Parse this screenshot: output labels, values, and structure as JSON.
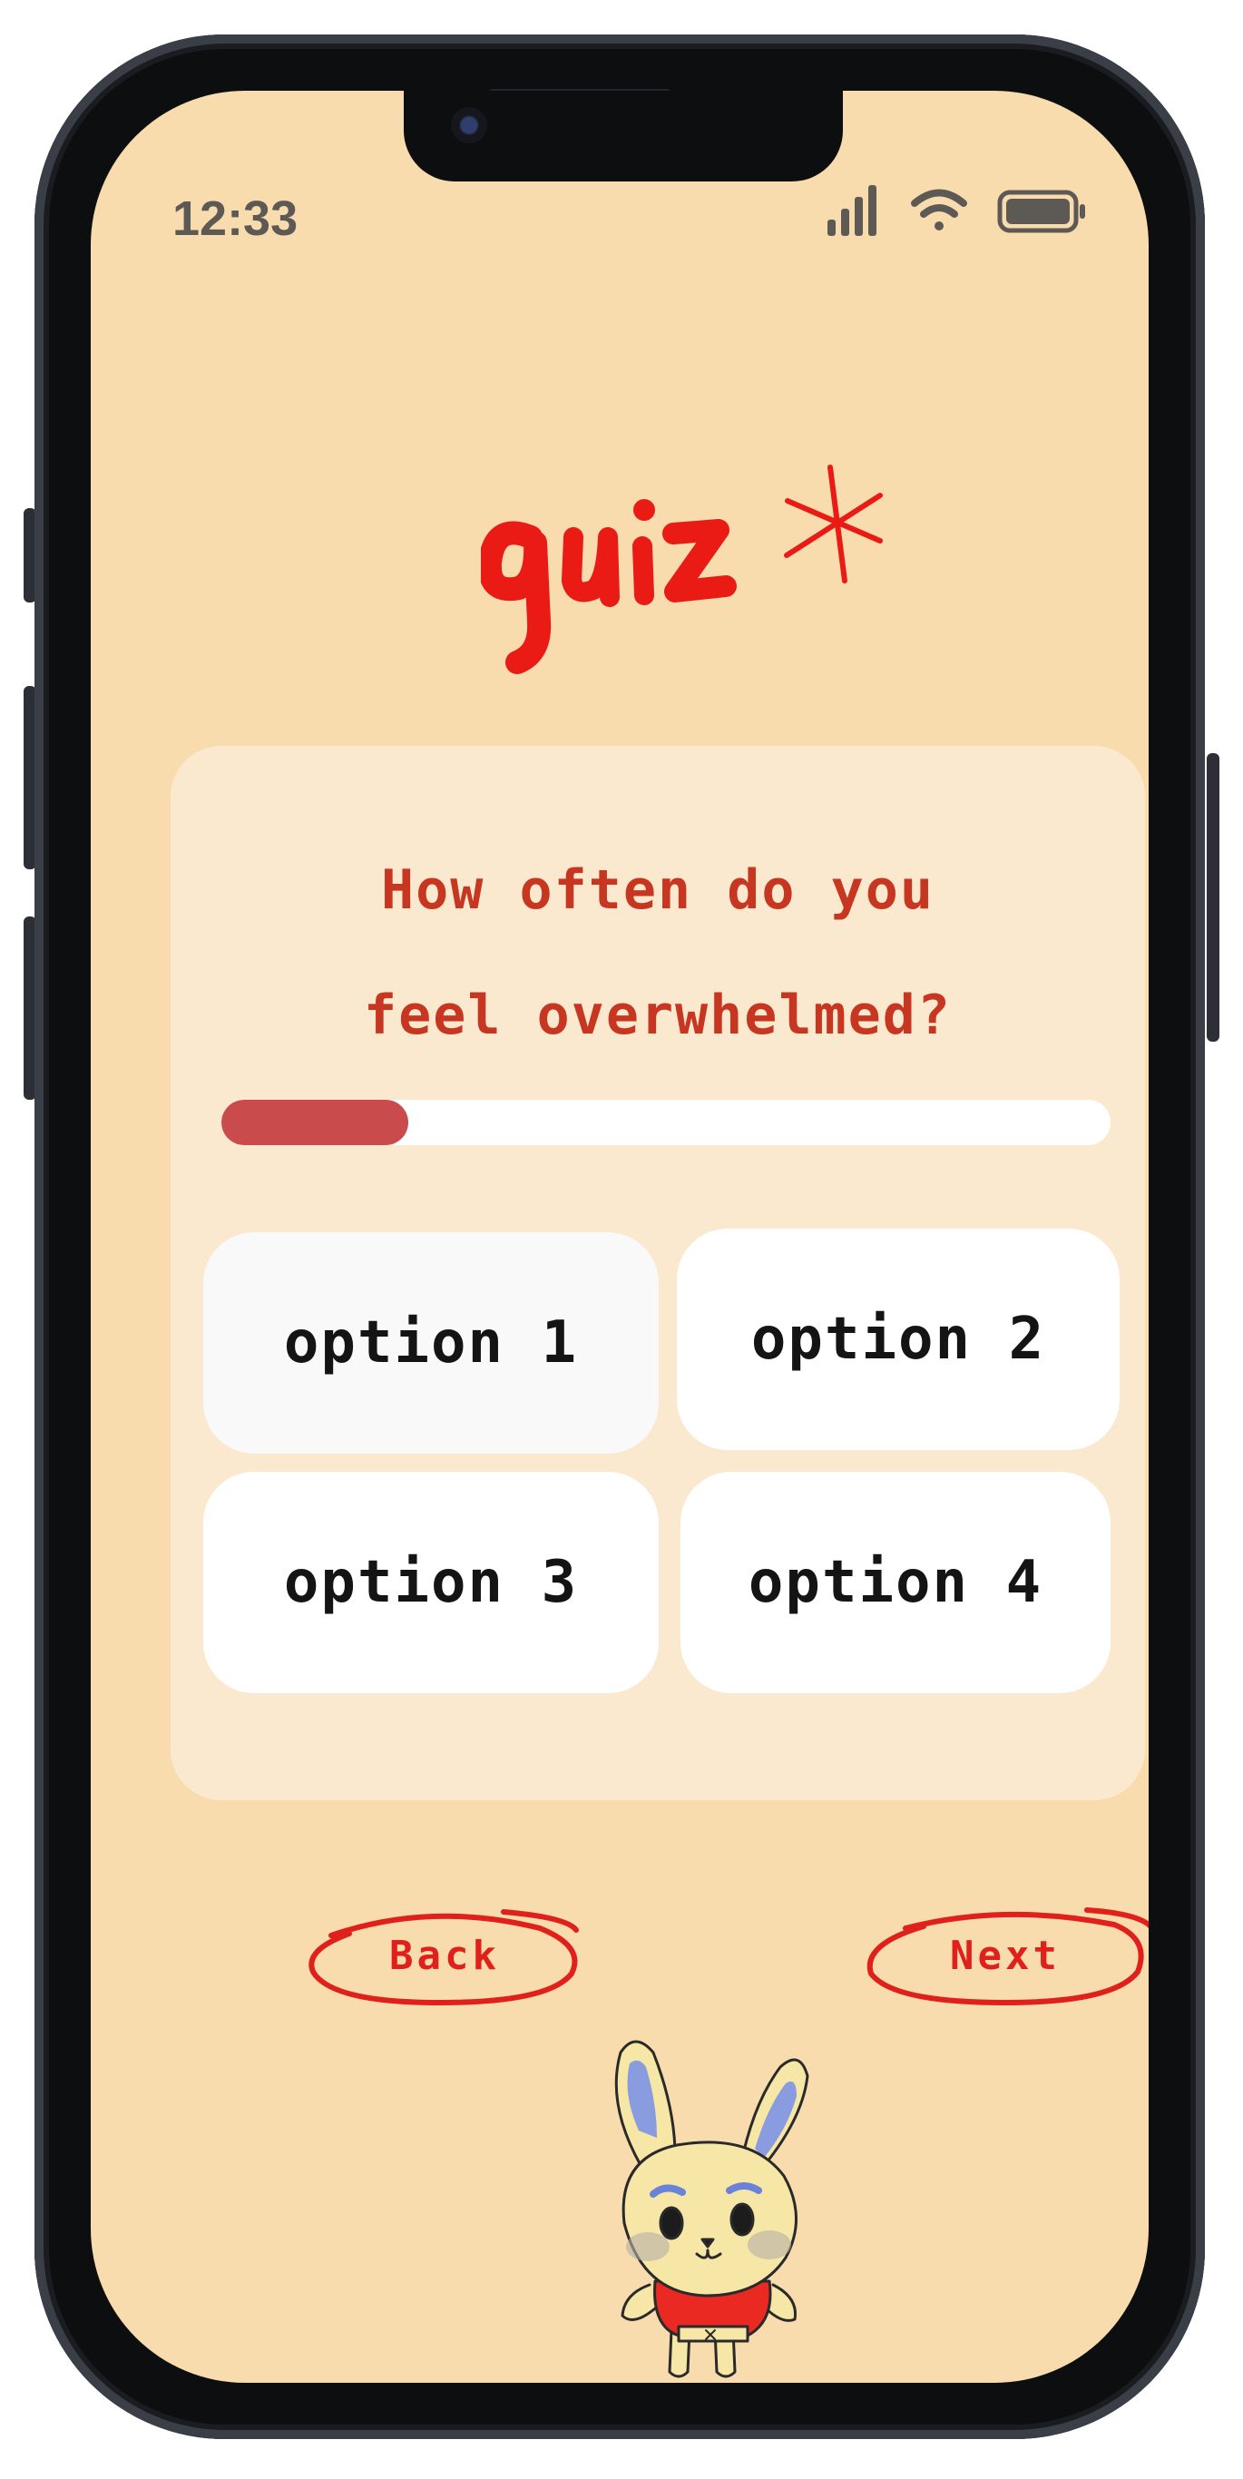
{
  "status_bar": {
    "time": "12:33"
  },
  "title": "quiz",
  "quiz": {
    "question_line1": "How often do you",
    "question_line2": "feel overwhelmed?",
    "progress": 0.21
  },
  "options": [
    "option 1",
    "option 2",
    "option 3",
    "option 4"
  ],
  "navigation": {
    "back_label": "Back",
    "next_label": "Next"
  },
  "colors": {
    "background": "#f8dcad",
    "card": "#fbe9cf",
    "accent_red": "#e0201a",
    "question_text": "#c73620",
    "progress_fill": "#c94b4b"
  }
}
